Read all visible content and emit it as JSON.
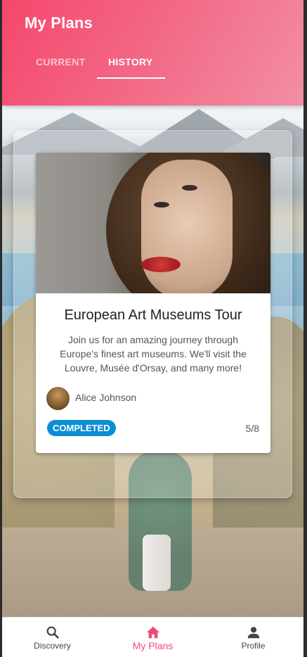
{
  "header": {
    "title": "My Plans",
    "tabs": [
      {
        "label": "CURRENT",
        "active": false
      },
      {
        "label": "HISTORY",
        "active": true
      }
    ]
  },
  "plan": {
    "title": "European Art Museums Tour",
    "description": "Join us for an amazing journey through Europe's finest art museums. We'll visit the Louvre, Musée d'Orsay, and many more!",
    "author": "Alice Johnson",
    "status": "COMPLETED",
    "progress": "5/8"
  },
  "nav": {
    "items": [
      {
        "label": "Discovery",
        "icon": "search-icon",
        "active": false
      },
      {
        "label": "My Plans",
        "icon": "home-icon",
        "active": true
      },
      {
        "label": "Profile",
        "icon": "person-icon",
        "active": false
      }
    ]
  },
  "colors": {
    "accent": "#ef4c74",
    "badge": "#0b8ed4",
    "header_start": "#f5476c",
    "header_end": "#f28ea4"
  }
}
